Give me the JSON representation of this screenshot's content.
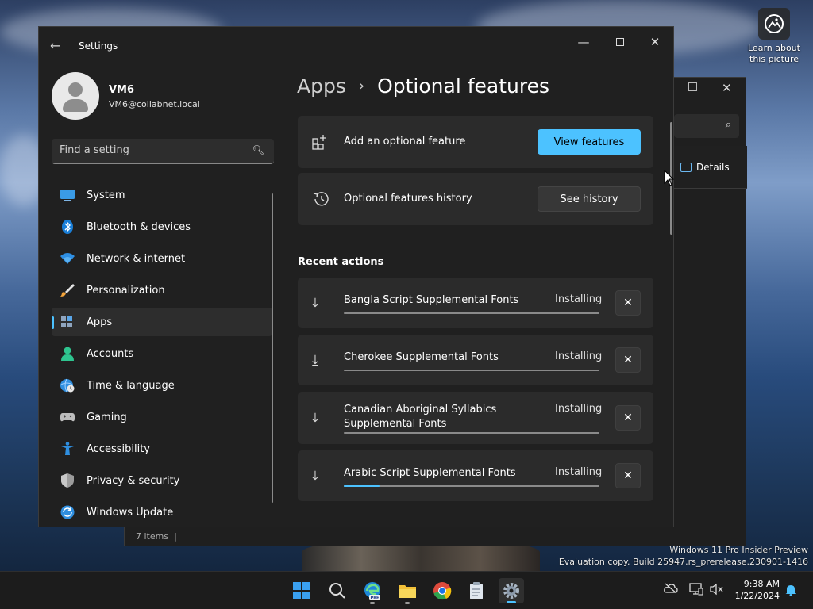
{
  "desktop": {
    "learn_label": "Learn about this picture",
    "watermark_line1": "Windows 11 Pro Insider Preview",
    "watermark_line2": "Evaluation copy. Build 25947.rs_prerelease.230901-1416"
  },
  "background_window": {
    "details_label": "Details",
    "status": "7 items"
  },
  "settings": {
    "title": "Settings",
    "user": {
      "name": "VM6",
      "email": "VM6@collabnet.local"
    },
    "search": {
      "placeholder": "Find a setting"
    },
    "nav": [
      {
        "label": "System",
        "icon": "system-icon"
      },
      {
        "label": "Bluetooth & devices",
        "icon": "bluetooth-icon"
      },
      {
        "label": "Network & internet",
        "icon": "wifi-icon"
      },
      {
        "label": "Personalization",
        "icon": "brush-icon"
      },
      {
        "label": "Apps",
        "icon": "apps-icon",
        "active": true
      },
      {
        "label": "Accounts",
        "icon": "person-icon"
      },
      {
        "label": "Time & language",
        "icon": "globe-clock-icon"
      },
      {
        "label": "Gaming",
        "icon": "gamepad-icon"
      },
      {
        "label": "Accessibility",
        "icon": "accessibility-icon"
      },
      {
        "label": "Privacy & security",
        "icon": "shield-icon"
      },
      {
        "label": "Windows Update",
        "icon": "update-icon"
      }
    ],
    "breadcrumb": {
      "parent": "Apps",
      "current": "Optional features"
    },
    "add_feature": {
      "label": "Add an optional feature",
      "button": "View features"
    },
    "history": {
      "label": "Optional features history",
      "button": "See history"
    },
    "recent_title": "Recent actions",
    "recent_actions": [
      {
        "name": "Bangla Script Supplemental Fonts",
        "status": "Installing",
        "progress": 0
      },
      {
        "name": "Cherokee Supplemental Fonts",
        "status": "Installing",
        "progress": 0
      },
      {
        "name": "Canadian Aboriginal Syllabics Supplemental Fonts",
        "status": "Installing",
        "progress": 0
      },
      {
        "name": "Arabic Script Supplemental Fonts",
        "status": "Installing",
        "progress": 0.14
      }
    ]
  },
  "taskbar": {
    "time": "9:38 AM",
    "date": "1/22/2024"
  },
  "colors": {
    "accent": "#4cc2ff",
    "window_bg": "#202020",
    "card_bg": "#2b2b2b"
  }
}
